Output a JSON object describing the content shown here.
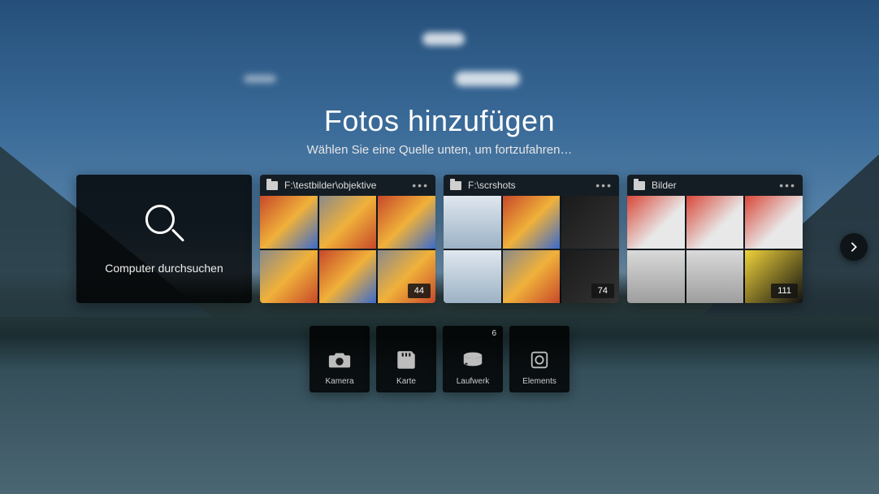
{
  "title": "Fotos hinzufügen",
  "subtitle": "Wählen Sie eine Quelle unten, um fortzufahren…",
  "search_card": {
    "label": "Computer durchsuchen"
  },
  "folders": [
    {
      "name": "F:\\testbilder\\objektive",
      "more_count": 44
    },
    {
      "name": "F:\\scrshots",
      "more_count": 74
    },
    {
      "name": "Bilder",
      "more_count": 111
    }
  ],
  "sources": {
    "camera": {
      "label": "Kamera"
    },
    "card": {
      "label": "Karte"
    },
    "drive": {
      "label": "Laufwerk",
      "count": 6
    },
    "elements": {
      "label": "Elements"
    }
  }
}
